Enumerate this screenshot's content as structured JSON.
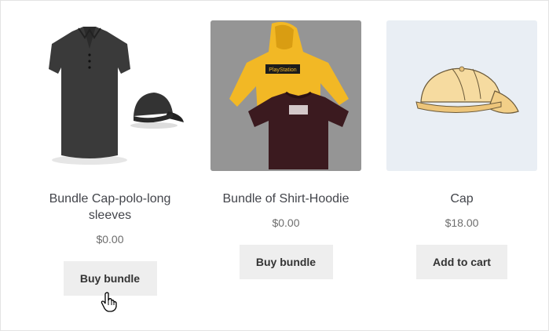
{
  "products": [
    {
      "title": "Bundle Cap-polo-long sleeves",
      "price": "$0.00",
      "button": "Buy bundle",
      "image": "polo-shirt-and-cap"
    },
    {
      "title": "Bundle of Shirt-Hoodie",
      "price": "$0.00",
      "button": "Buy bundle",
      "image": "hoodie-and-shirt-photo"
    },
    {
      "title": "Cap",
      "price": "$18.00",
      "button": "Add to cart",
      "image": "cap-illustration"
    }
  ],
  "hoodie_print": {
    "brand": "PlayStation"
  },
  "colors": {
    "button_bg": "#eeeeee",
    "price": "#6d6d6d",
    "hoodie": "#f2b825",
    "shirt": "#3b1a1f",
    "cap": "#f6dba0"
  },
  "cursor": {
    "icon": "hand-pointer-icon"
  }
}
